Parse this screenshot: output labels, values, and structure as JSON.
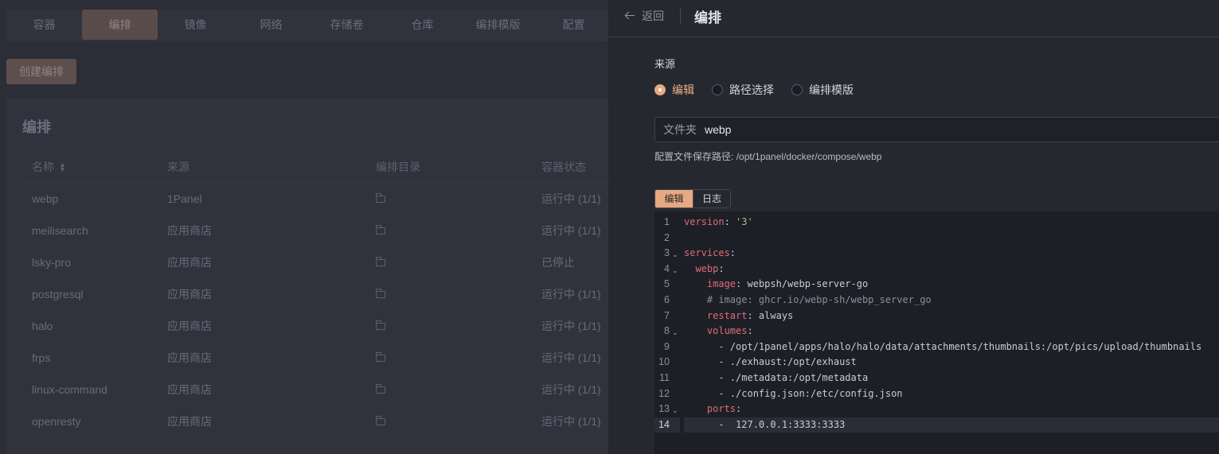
{
  "background": {
    "tabs": [
      "容器",
      "编排",
      "镜像",
      "网络",
      "存储卷",
      "仓库",
      "编排模版",
      "配置"
    ],
    "active_tab": 1,
    "create_button": "创建编排",
    "card_title": "编排",
    "table": {
      "headers": [
        "名称",
        "来源",
        "编排目录",
        "容器状态"
      ],
      "rows": [
        {
          "name": "webp",
          "source": "1Panel",
          "status": "运行中 (1/1)"
        },
        {
          "name": "meilisearch",
          "source": "应用商店",
          "status": "运行中 (1/1)"
        },
        {
          "name": "lsky-pro",
          "source": "应用商店",
          "status": "已停止"
        },
        {
          "name": "postgresql",
          "source": "应用商店",
          "status": "运行中 (1/1)"
        },
        {
          "name": "halo",
          "source": "应用商店",
          "status": "运行中 (1/1)"
        },
        {
          "name": "frps",
          "source": "应用商店",
          "status": "运行中 (1/1)"
        },
        {
          "name": "linux-command",
          "source": "应用商店",
          "status": "运行中 (1/1)"
        },
        {
          "name": "openresty",
          "source": "应用商店",
          "status": "运行中 (1/1)"
        }
      ]
    }
  },
  "drawer": {
    "back_label": "返回",
    "title": "编排",
    "source_label": "来源",
    "source_options": [
      "编辑",
      "路径选择",
      "编排模版"
    ],
    "source_selected": 0,
    "folder_prefix": "文件夹",
    "folder_value": "webp",
    "save_path_label": "配置文件保存路径:",
    "save_path_value": "/opt/1panel/docker/compose/webp",
    "editor_tabs": [
      "编辑",
      "日志"
    ],
    "editor_active_tab": 0,
    "colors": {
      "accent": "#e6a981",
      "key": "#e06c75",
      "string": "#98c379",
      "comment": "#8b8f9a"
    },
    "code_lines": [
      {
        "n": "1",
        "text": "version: '3'"
      },
      {
        "n": "2",
        "text": ""
      },
      {
        "n": "3",
        "text": "services:"
      },
      {
        "n": "4",
        "text": "  webp:"
      },
      {
        "n": "5",
        "text": "    image: webpsh/webp-server-go"
      },
      {
        "n": "6",
        "text": "    # image: ghcr.io/webp-sh/webp_server_go"
      },
      {
        "n": "7",
        "text": "    restart: always"
      },
      {
        "n": "8",
        "text": "    volumes:"
      },
      {
        "n": "9",
        "text": "      - /opt/1panel/apps/halo/halo/data/attachments/thumbnails:/opt/pics/upload/thumbnails"
      },
      {
        "n": "10",
        "text": "      - ./exhaust:/opt/exhaust"
      },
      {
        "n": "11",
        "text": "      - ./metadata:/opt/metadata"
      },
      {
        "n": "12",
        "text": "      - ./config.json:/etc/config.json"
      },
      {
        "n": "13",
        "text": "    ports:"
      },
      {
        "n": "14",
        "text": "      -  127.0.0.1:3333:3333"
      }
    ],
    "fold_lines": [
      "3",
      "4",
      "8",
      "13"
    ],
    "active_line": "14"
  }
}
